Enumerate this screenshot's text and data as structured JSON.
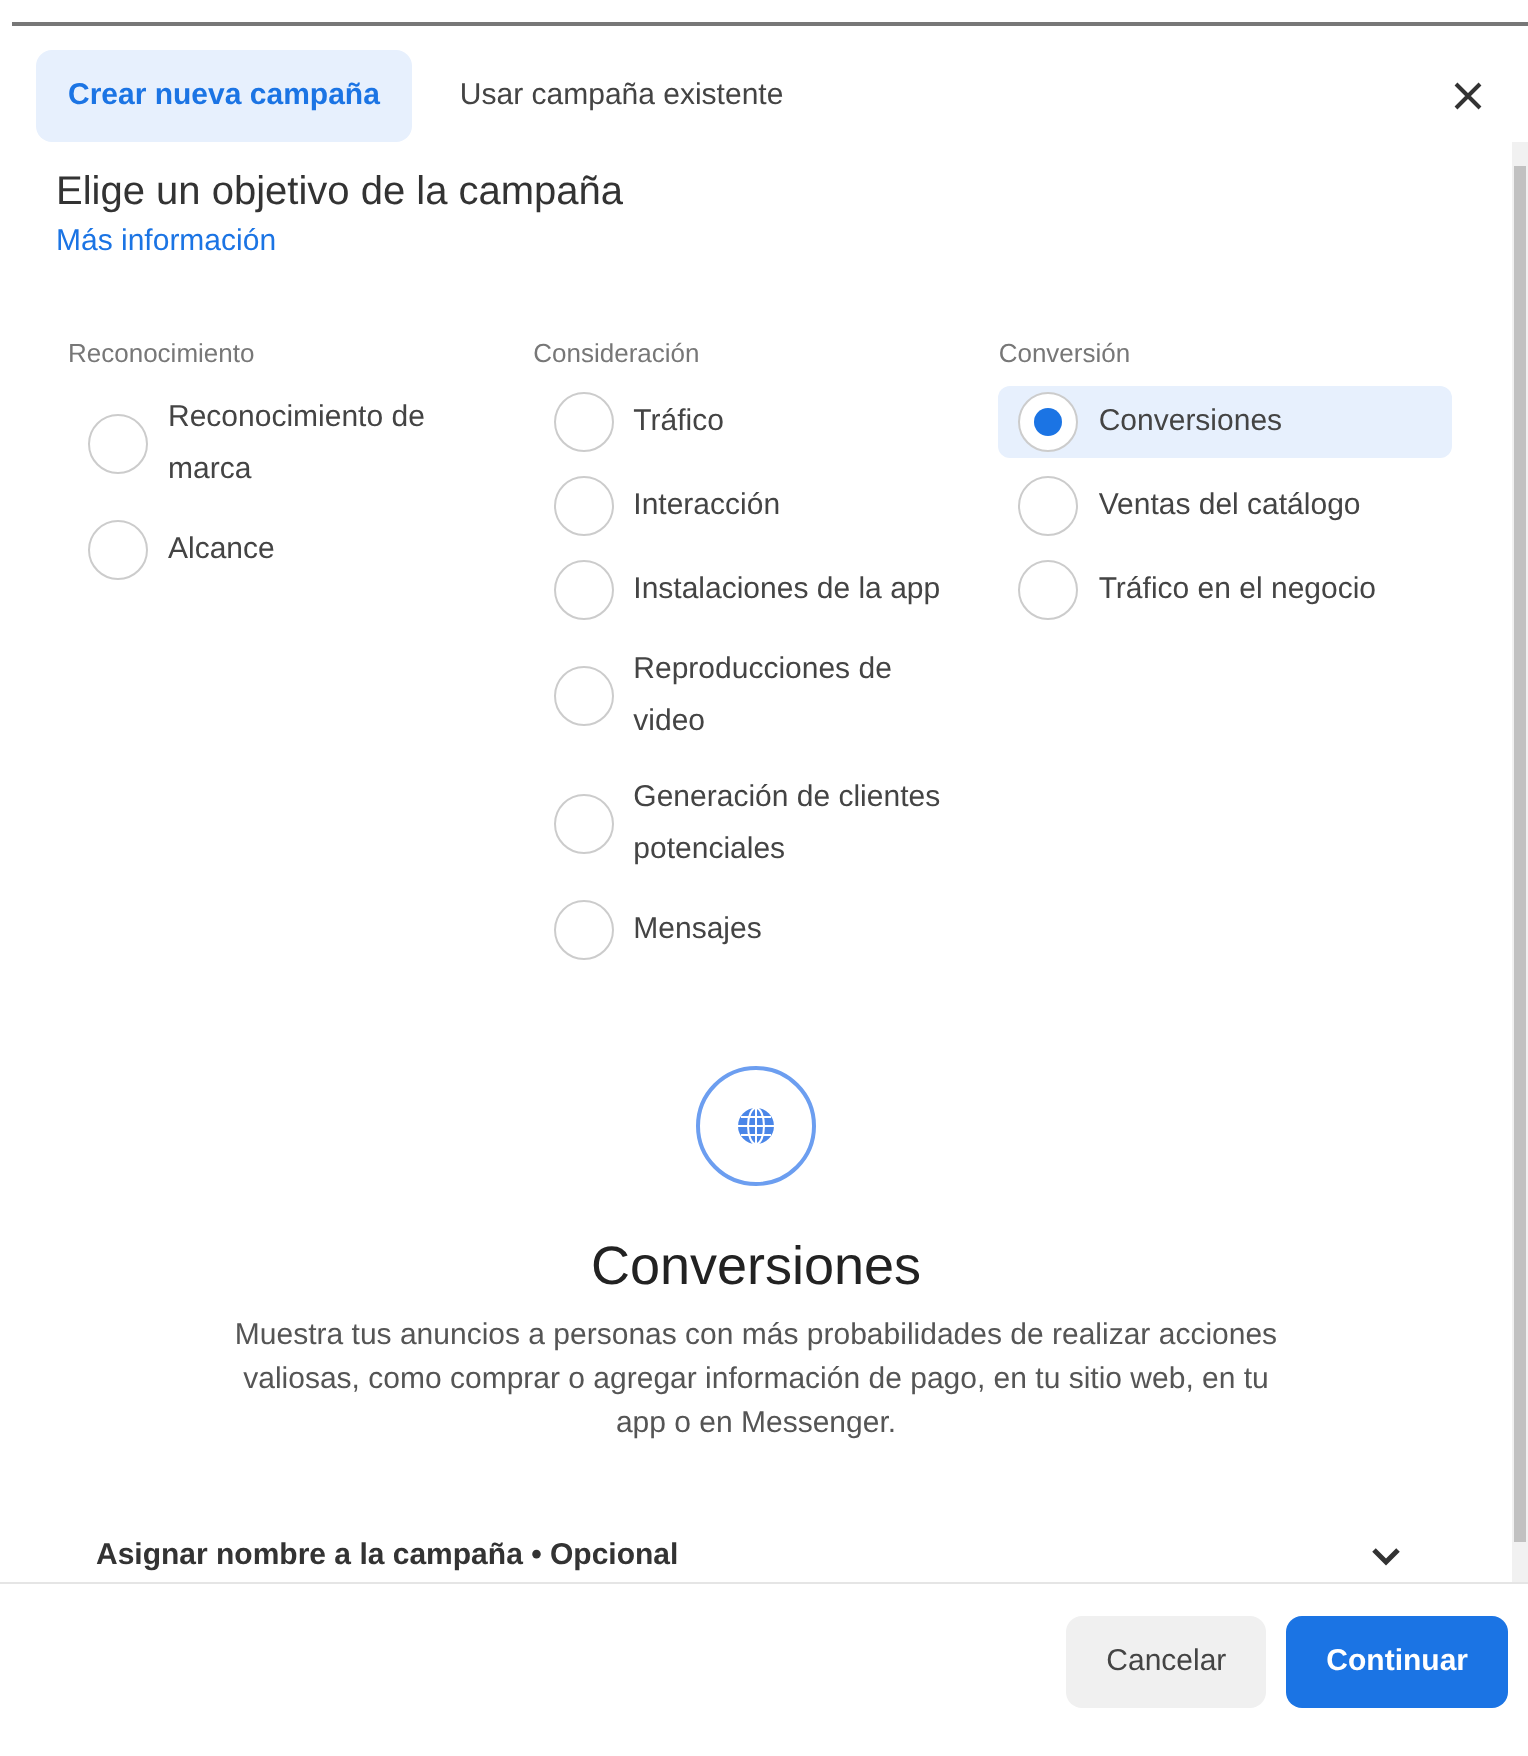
{
  "tabs": [
    {
      "label": "Crear nueva campaña",
      "selected": true
    },
    {
      "label": "Usar campaña existente",
      "selected": false
    }
  ],
  "heading": "Elige un objetivo de la campaña",
  "more_info_link": "Más información",
  "columns": [
    {
      "heading": "Reconocimiento",
      "options": [
        {
          "label": "Reconocimiento de marca",
          "selected": false
        },
        {
          "label": "Alcance",
          "selected": false
        }
      ]
    },
    {
      "heading": "Consideración",
      "options": [
        {
          "label": "Tráfico",
          "selected": false
        },
        {
          "label": "Interacción",
          "selected": false
        },
        {
          "label": "Instalaciones de la app",
          "selected": false
        },
        {
          "label": "Reproducciones de video",
          "selected": false
        },
        {
          "label": "Generación de clientes potenciales",
          "selected": false
        },
        {
          "label": "Mensajes",
          "selected": false
        }
      ]
    },
    {
      "heading": "Conversión",
      "options": [
        {
          "label": "Conversiones",
          "selected": true
        },
        {
          "label": "Ventas del catálogo",
          "selected": false
        },
        {
          "label": "Tráfico en el negocio",
          "selected": false
        }
      ]
    }
  ],
  "objective_detail": {
    "title": "Conversiones",
    "description": "Muestra tus anuncios a personas con más probabilidades de realizar acciones valiosas, como comprar o agregar información de pago, en tu sitio web, en tu app o en Messenger."
  },
  "name_section": {
    "label": "Asignar nombre a la campaña • Opcional",
    "expanded": false
  },
  "buttons": [
    {
      "label": "Cancelar",
      "kind": "secondary"
    },
    {
      "label": "Continuar",
      "kind": "primary"
    }
  ]
}
